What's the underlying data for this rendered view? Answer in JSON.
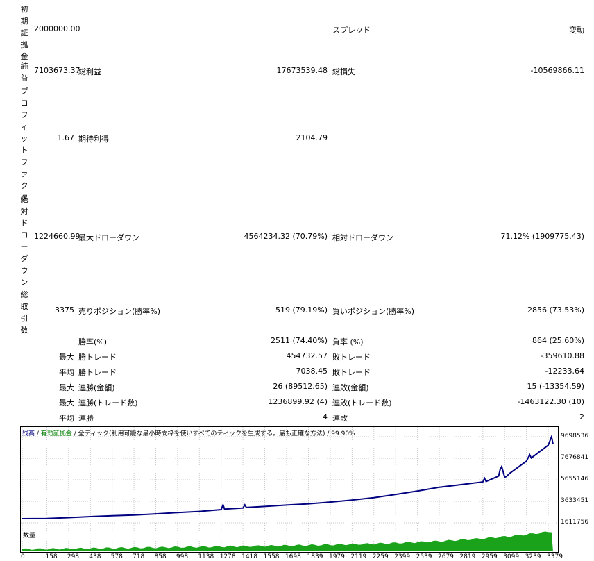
{
  "labels": {
    "initial_deposit": [
      "初",
      "期",
      "証",
      "拠",
      "金"
    ],
    "net_profit": [
      "純",
      "益"
    ],
    "profit_factor": [
      "プ",
      "ロ",
      "フ",
      "ィ",
      "ッ",
      "ト",
      "フ",
      "ァ",
      "ク",
      "タ"
    ],
    "abs_drawdown": [
      "絶",
      "対",
      "ド",
      "ロ",
      "ー",
      "ダ",
      "ウ",
      "ン"
    ],
    "total_trades": [
      "総",
      "取",
      "引",
      "数"
    ]
  },
  "rows": {
    "deposit": {
      "value": "2000000.00",
      "spread_label": "スプレッド",
      "spread_value": "変動"
    },
    "net": {
      "value": "7103673.37",
      "gross_profit_label": "総利益",
      "gross_profit": "17673539.48",
      "gross_loss_label": "総損失",
      "gross_loss": "-10569866.11"
    },
    "pf": {
      "value": "1.67",
      "expected_label": "期待利得",
      "expected": "2104.79"
    },
    "dd": {
      "value": "1224660.99",
      "max_dd_label": "最大ドローダウン",
      "max_dd": "4564234.32 (70.79%)",
      "rel_dd_label": "相対ドローダウン",
      "rel_dd": "71.12% (1909775.43)"
    },
    "trades": {
      "value": "3375",
      "sell_label": "売りポジション(勝率%)",
      "sell": "519 (79.19%)",
      "buy_label": "買いポジション(勝率%)",
      "buy": "2856 (73.53%)"
    },
    "winrate": {
      "label": "勝率(%)",
      "value": "2511 (74.40%)",
      "loss_label": "負率 (%)",
      "loss_value": "864 (25.60%)"
    },
    "max_trade": {
      "prefix": "最大",
      "label": "勝トレード",
      "value": "454732.57",
      "loss_label": "敗トレード",
      "loss_value": "-359610.88"
    },
    "avg_trade": {
      "prefix": "平均",
      "label": "勝トレード",
      "value": "7038.45",
      "loss_label": "敗トレード",
      "loss_value": "-12233.64"
    },
    "max_consec_amt": {
      "prefix": "最大",
      "label": "連勝(金額)",
      "value": "26 (89512.65)",
      "loss_label": "連敗(金額)",
      "loss_value": "15 (-13354.59)"
    },
    "max_consec_cnt": {
      "prefix": "最大",
      "label": "連勝(トレード数)",
      "value": "1236899.92 (4)",
      "loss_label": "連敗(トレード数)",
      "loss_value": "-1463122.30 (10)"
    },
    "avg_consec": {
      "prefix": "平均",
      "label": "連勝",
      "value": "4",
      "loss_label": "連敗",
      "loss_value": "2"
    }
  },
  "chart_title": {
    "balance": "残高",
    "sep1": " / ",
    "equity": "有効証拠金",
    "sep2": " / ",
    "ticks": "全ティック(利用可能な最小時間枠を使いすべてのティックを生成する。最も正確な方法)",
    "sep3": " / ",
    "quality": "99.90%"
  },
  "volume_label": "数量",
  "colors": {
    "balance": "#000080",
    "equity": "#008000",
    "volume": "#1aa31a"
  },
  "chart_data": {
    "type": "line",
    "series": [
      {
        "name": "残高",
        "x": [
          0,
          158,
          298,
          438,
          578,
          718,
          858,
          998,
          1138,
          1278,
          1290,
          1300,
          1418,
          1430,
          1440,
          1558,
          1698,
          1839,
          1979,
          2119,
          2259,
          2399,
          2539,
          2679,
          2819,
          2959,
          2970,
          2980,
          3060,
          3070,
          3080,
          3099,
          3110,
          3130,
          3239,
          3260,
          3270,
          3379,
          3400,
          3410
        ],
        "y": [
          2000000,
          2020000,
          2100000,
          2200000,
          2280000,
          2350000,
          2450000,
          2580000,
          2680000,
          2850000,
          3300000,
          2900000,
          3000000,
          3300000,
          3050000,
          3150000,
          3280000,
          3400000,
          3560000,
          3750000,
          3980000,
          4280000,
          4600000,
          4950000,
          5200000,
          5450000,
          5800000,
          5500000,
          6000000,
          6600000,
          6900000,
          5900000,
          5950000,
          6250000,
          7400000,
          8000000,
          7700000,
          8900000,
          9698536,
          9000000
        ]
      }
    ],
    "ylim": [
      1611756,
      9698536
    ],
    "y_ticks": [
      "9698536",
      "7676841",
      "5655146",
      "3633451",
      "1611756"
    ],
    "x_ticks": [
      "0",
      "158",
      "298",
      "438",
      "578",
      "718",
      "858",
      "998",
      "1138",
      "1278",
      "1418",
      "1558",
      "1698",
      "1839",
      "1979",
      "2119",
      "2259",
      "2399",
      "2539",
      "2679",
      "2819",
      "2959",
      "3099",
      "3239",
      "3379"
    ]
  }
}
